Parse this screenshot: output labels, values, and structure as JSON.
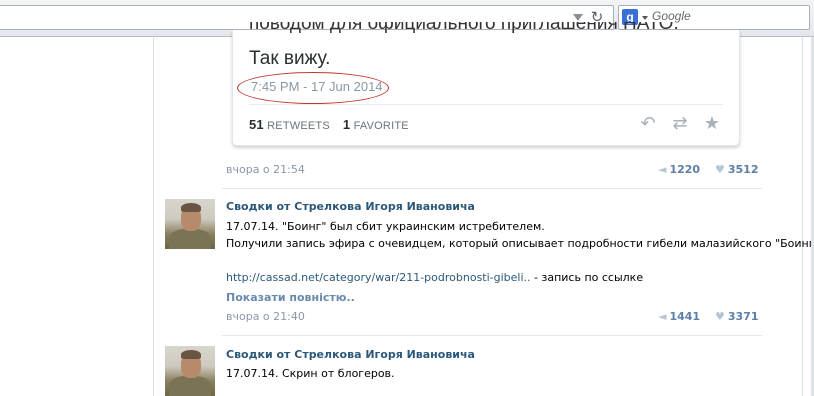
{
  "browser": {
    "search_placeholder": "Google",
    "search_engine_letter": "g"
  },
  "tweet": {
    "text_cut": "поводом для официального приглашения НАТО.",
    "text": "Так вижу.",
    "timestamp": "7:45 PM - 17 Jun 2014",
    "retweets_count": "51",
    "retweets_label": "RETWEETS",
    "favorites_count": "1",
    "favorites_label": "FAVORITE"
  },
  "posts": [
    {
      "meta_time": "вчора о 21:54",
      "reposts": "1220",
      "likes": "3512"
    },
    {
      "author": "Сводки от Стрелкова Игоря Ивановича",
      "line1": "17.07.14. \"Боинг\" был сбит украинским истребителем.",
      "line2": "Получили запись эфира с очевидцем, который описывает подробности гибели малазийского \"Боинга\".",
      "link": "http://cassad.net/category/war/211-podrobnosti-gibeli..",
      "link_suffix": " - запись по ссылке",
      "show_more": "Показати повністю..",
      "meta_time": "вчора о 21:40",
      "reposts": "1441",
      "likes": "3371"
    },
    {
      "author": "Сводки от Стрелкова Игоря Ивановича",
      "line1": "17.07.14. Скрин от блогеров."
    }
  ],
  "icons": {
    "reply": "reply-icon",
    "retweet": "retweet-icon",
    "favorite": "star-icon",
    "repost": "megaphone-icon",
    "like": "heart-icon"
  }
}
